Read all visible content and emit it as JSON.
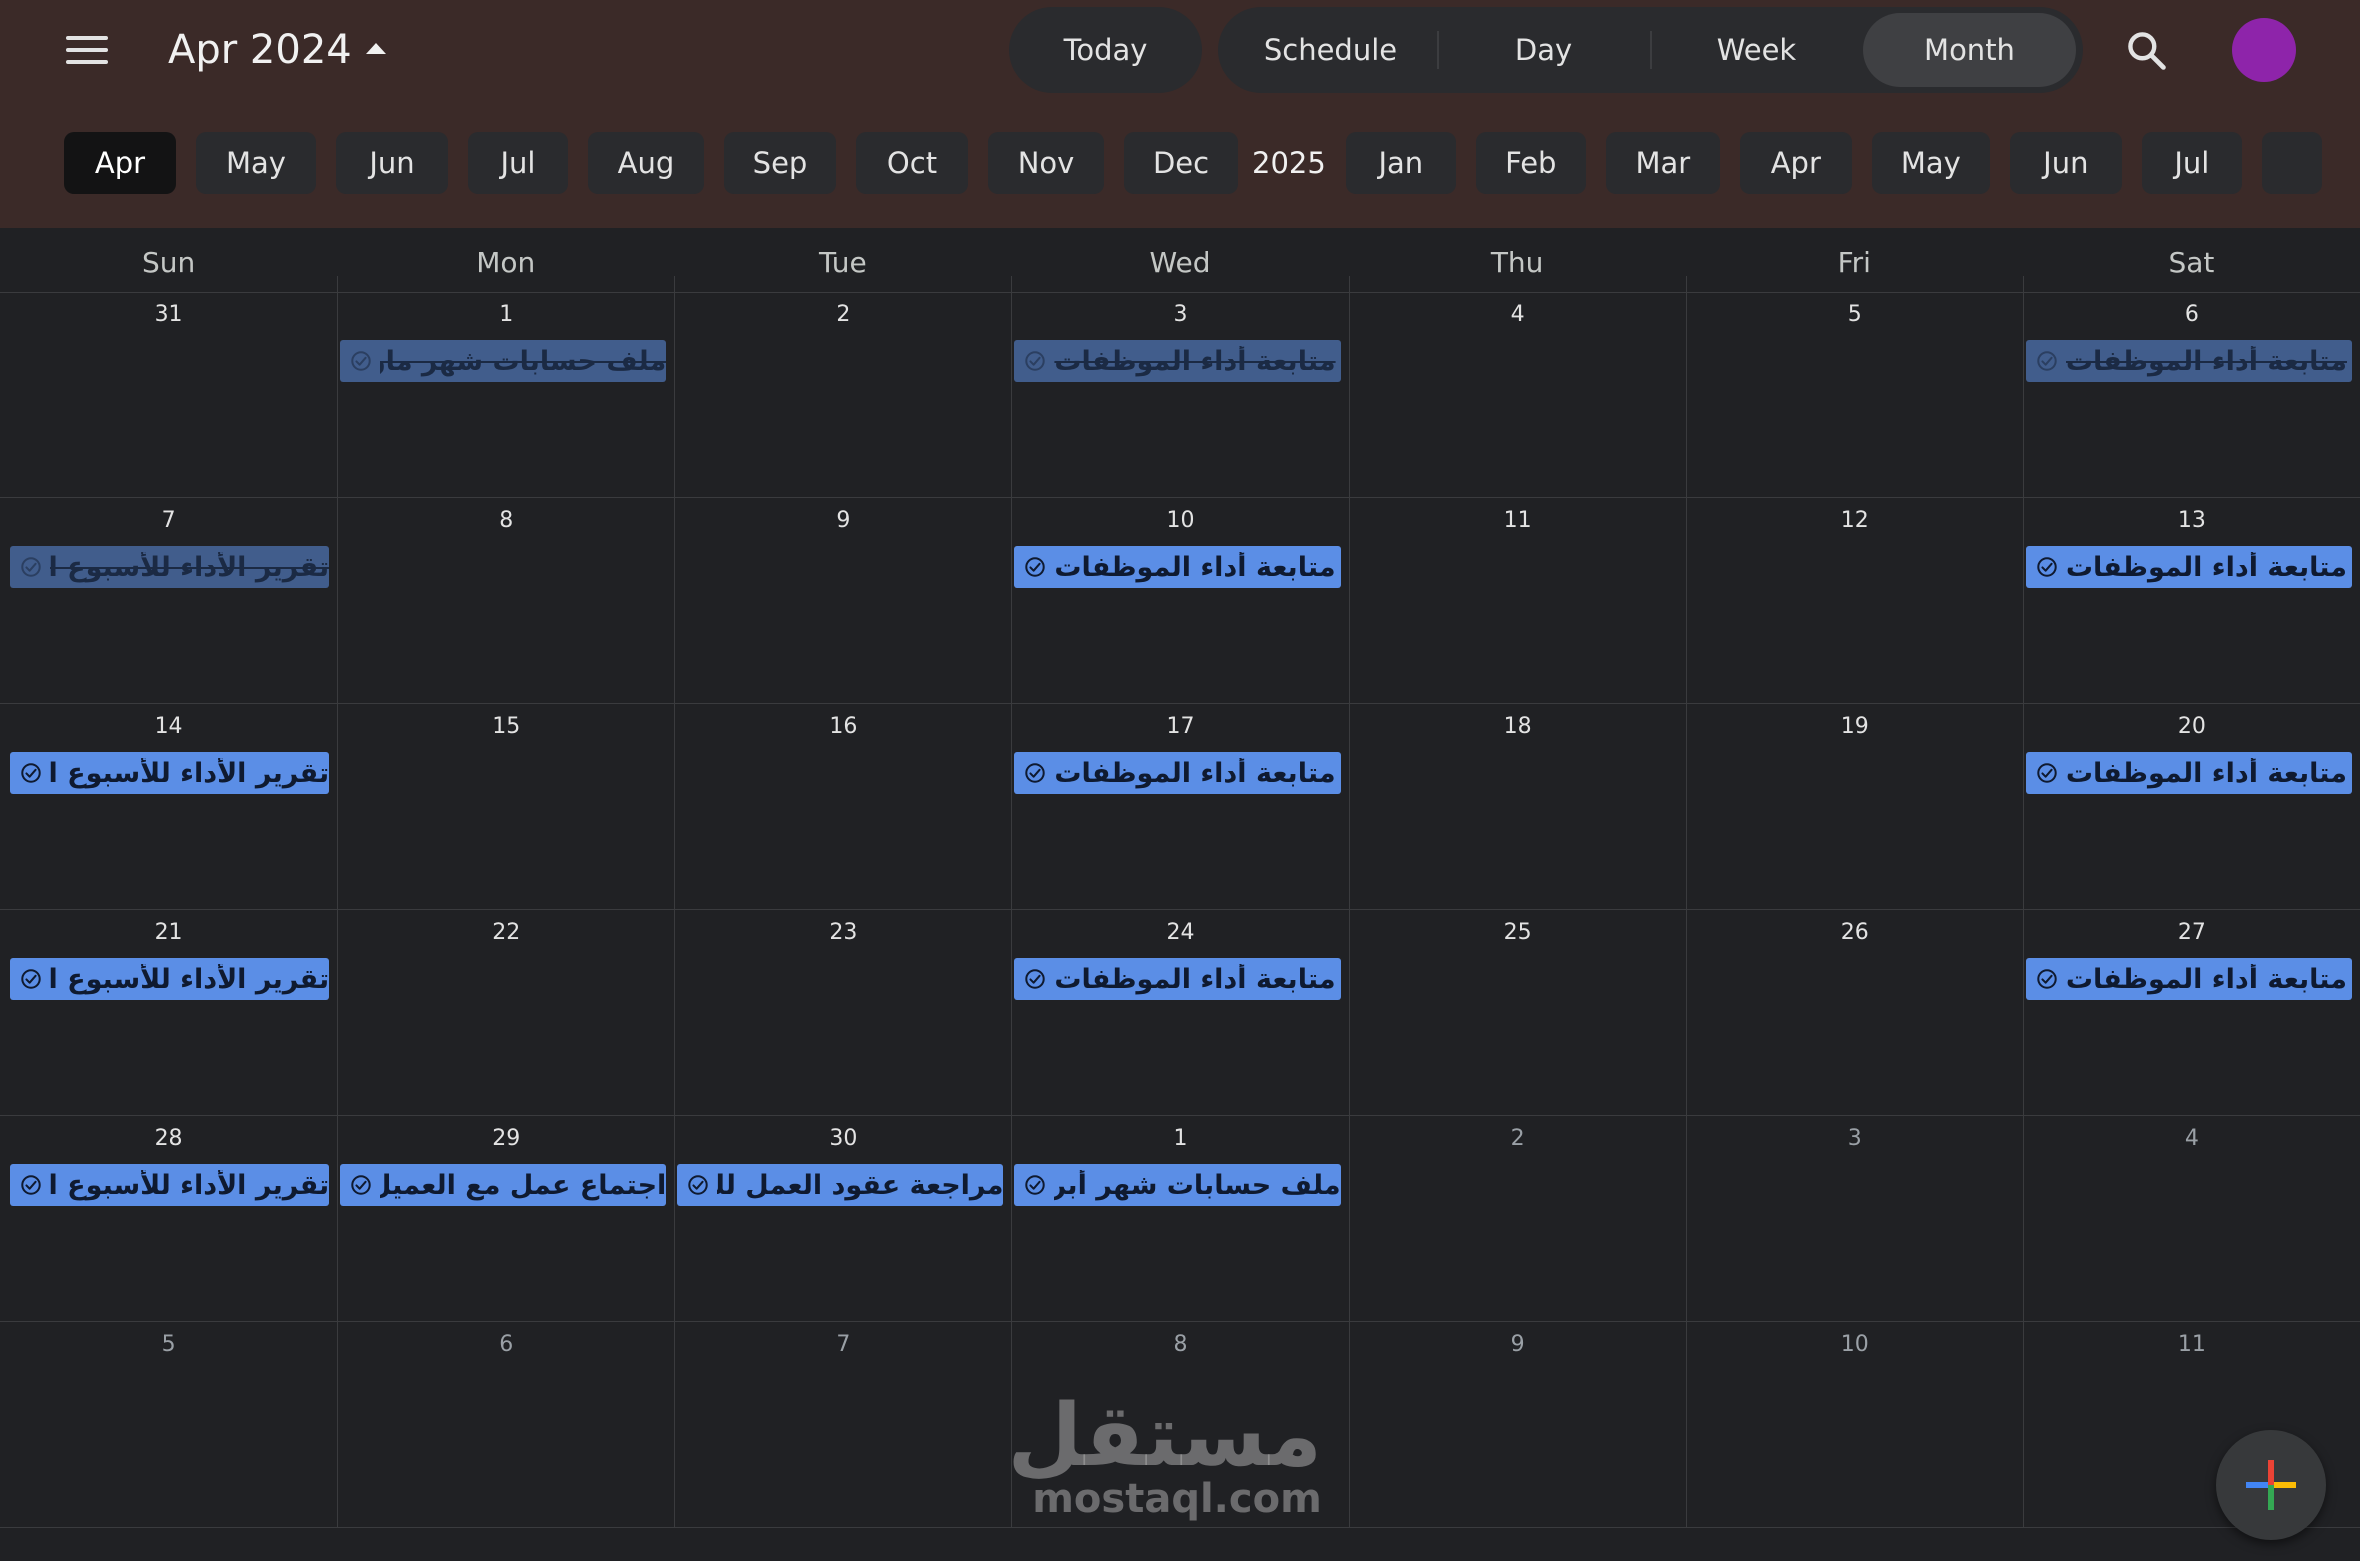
{
  "header": {
    "title": "Apr 2024",
    "today_label": "Today",
    "views": [
      {
        "label": "Schedule",
        "active": false
      },
      {
        "label": "Day",
        "active": false
      },
      {
        "label": "Week",
        "active": false
      },
      {
        "label": "Month",
        "active": true
      }
    ],
    "icons": {
      "menu": "hamburger-menu-icon",
      "title_caret": "caret-up-icon",
      "search": "search-icon"
    },
    "avatar_color": "#8e24aa"
  },
  "month_strip": {
    "items": [
      {
        "label": "Apr",
        "active": true
      },
      {
        "label": "May"
      },
      {
        "label": "Jun"
      },
      {
        "label": "Jul"
      },
      {
        "label": "Aug"
      },
      {
        "label": "Sep"
      },
      {
        "label": "Oct"
      },
      {
        "label": "Nov"
      },
      {
        "label": "Dec"
      },
      {
        "label": "2025",
        "year": true
      },
      {
        "label": "Jan"
      },
      {
        "label": "Feb"
      },
      {
        "label": "Mar"
      },
      {
        "label": "Apr"
      },
      {
        "label": "May"
      },
      {
        "label": "Jun"
      },
      {
        "label": "Jul"
      }
    ]
  },
  "weekdays": [
    "Sun",
    "Mon",
    "Tue",
    "Wed",
    "Thu",
    "Fri",
    "Sat"
  ],
  "days": [
    {
      "n": "31",
      "muted": false
    },
    {
      "n": "1",
      "event": "ملف حسابات شهر مارس",
      "done": true
    },
    {
      "n": "2"
    },
    {
      "n": "3",
      "event": "متابعة أداء الموظفات",
      "done": true
    },
    {
      "n": "4"
    },
    {
      "n": "5"
    },
    {
      "n": "6",
      "event": "متابعة أداء الموظفات",
      "done": true
    },
    {
      "n": "7",
      "event": "تقرير الأداء للأسبوع الأول",
      "done": true
    },
    {
      "n": "8"
    },
    {
      "n": "9"
    },
    {
      "n": "10",
      "event": "متابعة أداء الموظفات"
    },
    {
      "n": "11"
    },
    {
      "n": "12"
    },
    {
      "n": "13",
      "event": "متابعة أداء الموظفات"
    },
    {
      "n": "14",
      "event": "تقرير الأداء للأسبوع الثاني"
    },
    {
      "n": "15"
    },
    {
      "n": "16"
    },
    {
      "n": "17",
      "event": "متابعة أداء الموظفات"
    },
    {
      "n": "18"
    },
    {
      "n": "19"
    },
    {
      "n": "20",
      "event": "متابعة أداء الموظفات"
    },
    {
      "n": "21",
      "event": "تقرير الأداء للأسبوع الثالث"
    },
    {
      "n": "22"
    },
    {
      "n": "23"
    },
    {
      "n": "24",
      "event": "متابعة أداء الموظفات"
    },
    {
      "n": "25"
    },
    {
      "n": "26"
    },
    {
      "n": "27",
      "event": "متابعة أداء الموظفات"
    },
    {
      "n": "28",
      "event": "تقرير الأداء للأسبوع الرابع"
    },
    {
      "n": "29",
      "event": "اجتماع عمل مع العميل لشهر مايو"
    },
    {
      "n": "30",
      "event": "مراجعة عقود العمل للموظفات"
    },
    {
      "n": "1",
      "event": "ملف حسابات شهر أبريل"
    },
    {
      "n": "2",
      "muted": true
    },
    {
      "n": "3",
      "muted": true
    },
    {
      "n": "4",
      "muted": true
    },
    {
      "n": "5",
      "muted": true
    },
    {
      "n": "6",
      "muted": true
    },
    {
      "n": "7",
      "muted": true
    },
    {
      "n": "8",
      "muted": true
    },
    {
      "n": "9",
      "muted": true
    },
    {
      "n": "10",
      "muted": true
    },
    {
      "n": "11",
      "muted": true
    }
  ],
  "event_icon": "task-check-circle-icon",
  "watermark": {
    "arabic": "مستقل",
    "latin": "mostaql.com"
  },
  "fab": {
    "icon": "google-plus-icon"
  },
  "colors": {
    "topbar": "#3b2a28",
    "background": "#202124",
    "event": "#5b8ee6",
    "event_done": "#415d8c"
  }
}
